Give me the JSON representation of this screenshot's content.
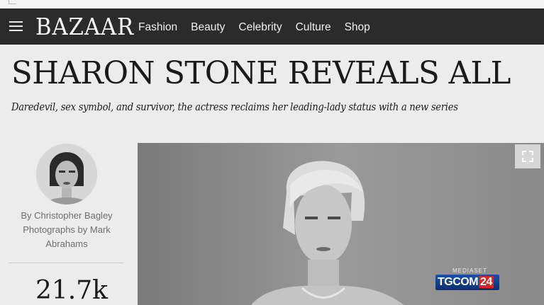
{
  "header": {
    "logo": "BAZAAR",
    "nav": [
      "Fashion",
      "Beauty",
      "Celebrity",
      "Culture",
      "Shop"
    ]
  },
  "article": {
    "title": "SHARON STONE REVEALS ALL",
    "dek": "Daredevil, sex symbol, and survivor, the actress reclaims her leading-lady status with a new series",
    "byline": [
      "By Christopher Bagley",
      "Photographs by Mark",
      "Abrahams"
    ],
    "share_count": "21.7k"
  },
  "overlay": {
    "network_top": "MEDIASET",
    "network_logo_left": "TGCOM",
    "network_logo_right": "24"
  },
  "icons": {
    "menu": "hamburger-icon",
    "expand": "expand-icon"
  }
}
